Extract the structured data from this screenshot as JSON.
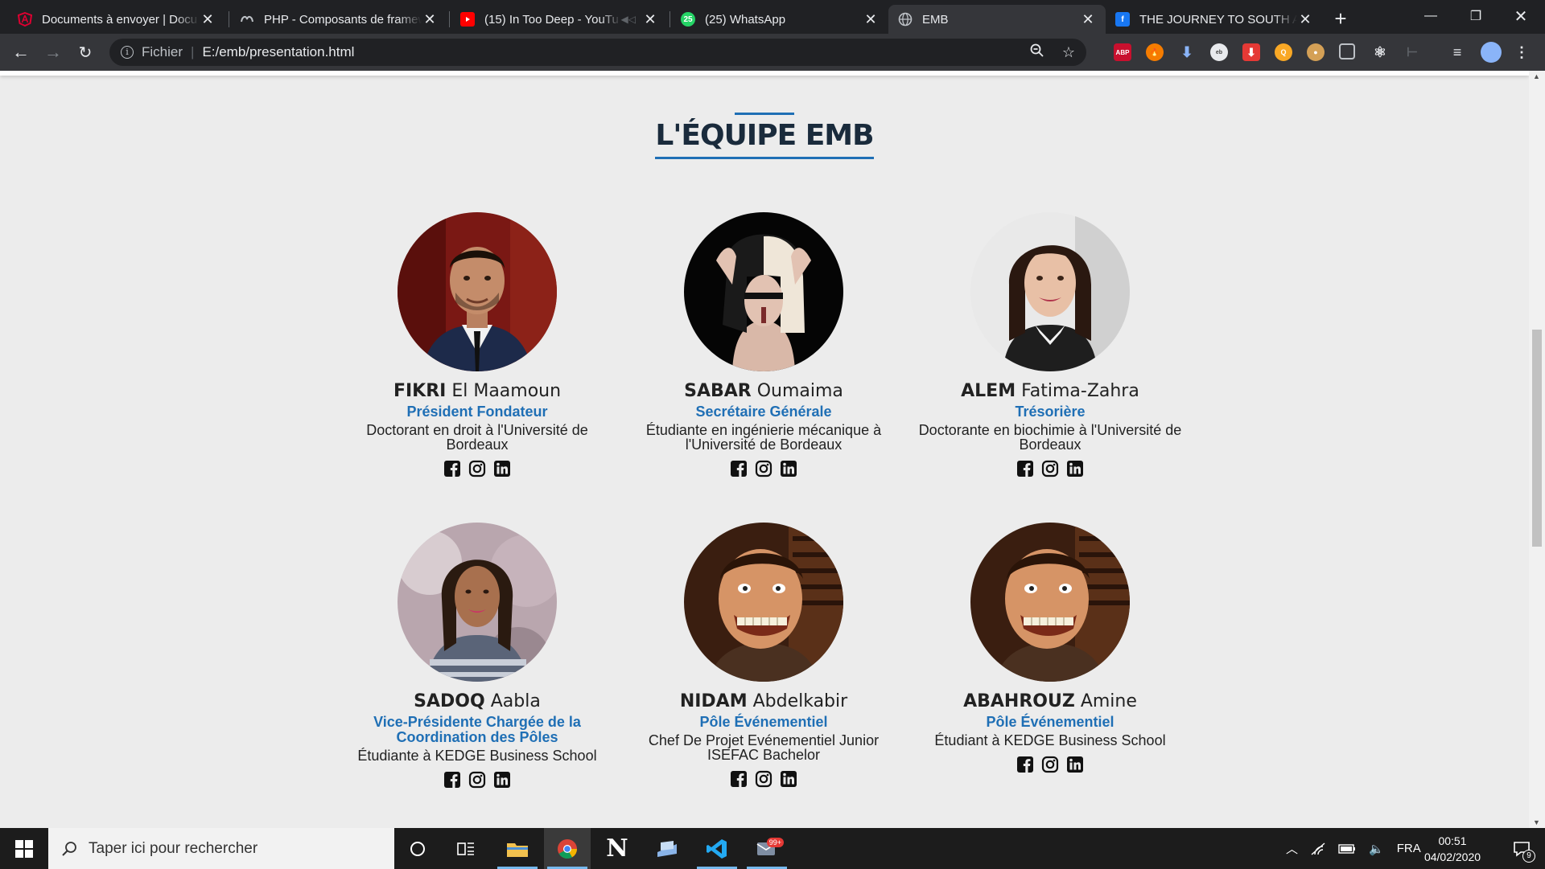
{
  "browser": {
    "tabs": [
      {
        "title": "Documents à envoyer | Docu",
        "icon": "angular-icon",
        "color": "#dd0031"
      },
      {
        "title": "PHP - Composants de framew",
        "icon": "openclassrooms-icon",
        "color": "#9aa0a6"
      },
      {
        "title": "(15) In Too Deep - YouTu",
        "icon": "youtube-icon",
        "color": "#ff0000"
      },
      {
        "title": "(25) WhatsApp",
        "icon": "whatsapp-icon",
        "color": "#25d366",
        "badge": "25"
      },
      {
        "title": "EMB",
        "icon": "globe-icon",
        "color": "#9aa0a6"
      },
      {
        "title": "THE JOURNEY TO SOUTH AF",
        "icon": "facebook-icon",
        "color": "#1877f2"
      }
    ],
    "address": {
      "scheme": "Fichier",
      "url": "E:/emb/presentation.html"
    },
    "extensions": {
      "abp": "ABP"
    }
  },
  "page": {
    "title": "L'ÉQUIPE EMB",
    "members": [
      {
        "last": "FIKRI",
        "first": "El Maamoun",
        "role": "Président Fondateur",
        "desc": "Doctorant en droit à l'Université de Bordeaux"
      },
      {
        "last": "SABAR",
        "first": "Oumaima",
        "role": "Secrétaire Générale",
        "desc": "Étudiante en ingénierie mécanique à l'Université de Bordeaux"
      },
      {
        "last": "ALEM",
        "first": "Fatima-Zahra",
        "role": "Trésorière",
        "desc": "Doctorante en biochimie à l'Université de Bordeaux"
      },
      {
        "last": "SADOQ",
        "first": "Aabla",
        "role": "Vice-Présidente Chargée de la Coordination des Pôles",
        "desc": "Étudiante à KEDGE Business School"
      },
      {
        "last": "NIDAM",
        "first": "Abdelkabir",
        "role": "Pôle Événementiel",
        "desc": "Chef De Projet Evénementiel Junior ISEFAC Bachelor"
      },
      {
        "last": "ABAHROUZ",
        "first": "Amine",
        "role": "Pôle Événementiel",
        "desc": "Étudiant à KEDGE Business School"
      }
    ],
    "accent": "#1f6fb5"
  },
  "taskbar": {
    "search_placeholder": "Taper ici pour rechercher",
    "lang": "FRA",
    "time": "00:51",
    "date": "04/02/2020",
    "notif_count": "9",
    "mail_badge": "99+"
  }
}
